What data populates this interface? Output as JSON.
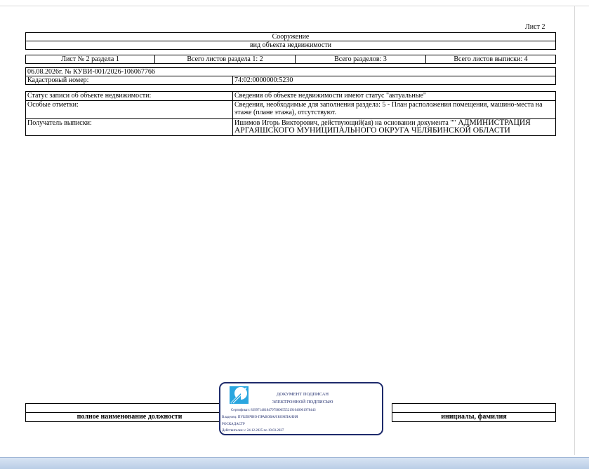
{
  "sheet_label": "Лист 2",
  "header": {
    "object_type": "Сооружение",
    "object_kind_label": "вид объекта недвижимости"
  },
  "sheets": {
    "sheet_of_section": "Лист № 2 раздела 1",
    "total_sheets_section": "Всего листов раздела 1: 2",
    "total_sections": "Всего разделов: 3",
    "total_sheets_extract": "Всего листов выписки: 4"
  },
  "extract": {
    "date_number": "06.08.2026г. № КУВИ-001/2026-106067766",
    "cadastral_label": "Кадастровый номер:",
    "cadastral_value": "74:02:0000000:5230"
  },
  "rows": [
    {
      "label": "Статус записи об объекте недвижимости:",
      "value": "Сведения об объекте недвижимости имеют статус \"актуальные\""
    },
    {
      "label": "Особые отметки:",
      "value": "Сведения, необходимые для заполнения раздела: 5 - План расположения помещения, машино-места на этаже (плане этажа), отсутствуют."
    },
    {
      "label": "Получатель выписки:",
      "value_part1": "Ишимов Игорь Викторович, действующий(ая) на основании документа \"\"",
      "value_part2": " АДМИНИСТРАЦИЯ АРГАЯШСКОГО МУНИЦИПАЛЬНОГО ОКРУГА ЧЕЛЯБИНСКОЙ ОБЛАСТИ"
    }
  ],
  "signature": {
    "position_label": "полное наименование должности",
    "name_label": "инициалы, фамилия"
  },
  "stamp": {
    "title1": "ДОКУМЕНТ ПОДПИСАН",
    "title2": "ЭЛЕКТРОННОЙ ПОДПИСЬЮ",
    "certificate": "Сертификат: 839971481847979800555219104000197844З",
    "owner": "Владелец: ПУБЛИЧНО-ПРАВОВАЯ КОМПАНИЯ",
    "owner2": "РОСКАДАСТР",
    "valid": "Действителен: с 24.12.2025 по 19.03.2027"
  },
  "colors": {
    "stamp": "#1d2a6b",
    "stamp_logo": "#2aa6df"
  }
}
